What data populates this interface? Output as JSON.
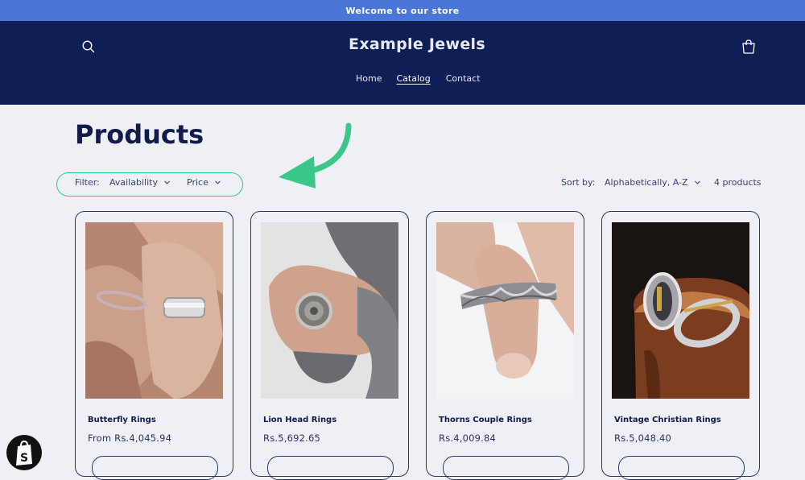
{
  "announcement": "Welcome to our store",
  "header": {
    "brand": "Example Jewels",
    "nav": [
      {
        "label": "Home",
        "active": false
      },
      {
        "label": "Catalog",
        "active": true
      },
      {
        "label": "Contact",
        "active": false
      }
    ],
    "icons": {
      "search": "search-icon",
      "cart": "cart-icon"
    }
  },
  "page": {
    "title": "Products"
  },
  "filters": {
    "label": "Filter:",
    "availability": "Availability",
    "price": "Price",
    "sort_label": "Sort by:",
    "sort_value": "Alphabetically, A-Z",
    "count": "4 products"
  },
  "annotation": {
    "arrow_color": "#3bc78a"
  },
  "products": [
    {
      "name": "Butterfly Rings",
      "price": "From Rs.4,045.94",
      "image": "couple-rings-photo"
    },
    {
      "name": "Lion Head Rings",
      "price": "Rs.5,692.65",
      "image": "lion-ring-photo"
    },
    {
      "name": "Thorns Couple Rings",
      "price": "Rs.4,009.84",
      "image": "thorns-ring-photo"
    },
    {
      "name": "Vintage Christian Rings",
      "price": "Rs.5,048.40",
      "image": "christian-rings-photo"
    }
  ],
  "colors": {
    "header_bg": "#0f1f56",
    "announce_bg": "#4a76d8",
    "page_bg": "#eef0f5"
  }
}
